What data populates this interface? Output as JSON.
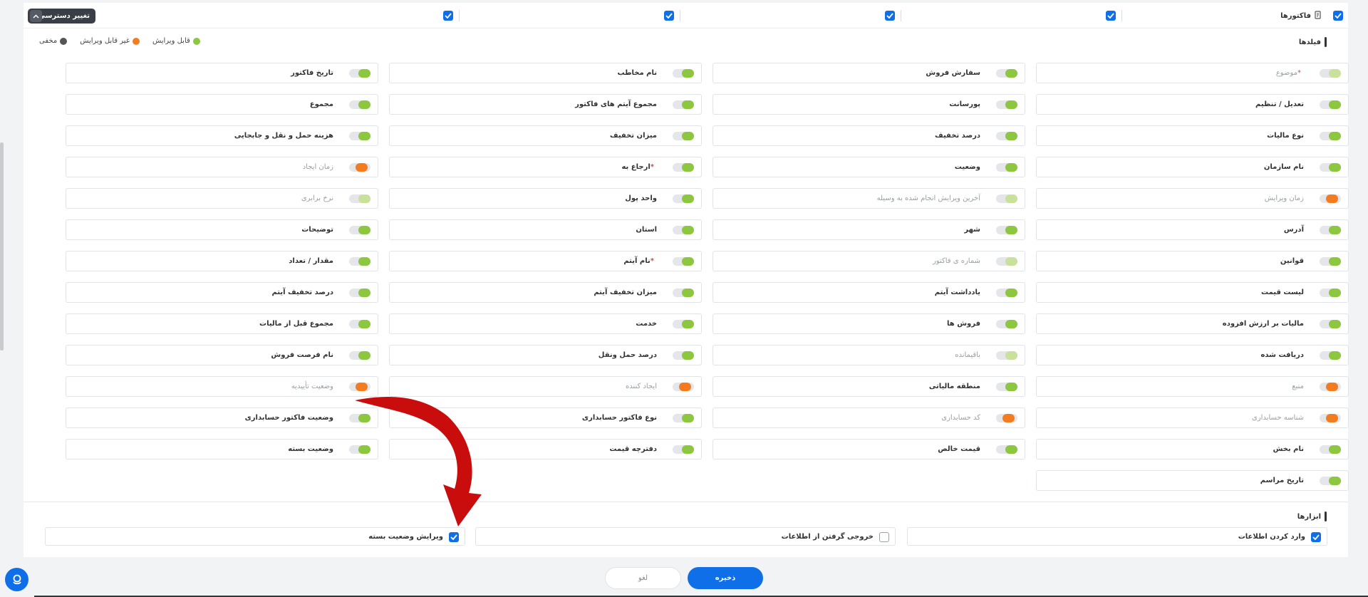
{
  "header": {
    "access_button_label": "تغییر دسترسی",
    "module_title": "فاکتورها"
  },
  "fields_section": {
    "title": "فیلدها",
    "legend": [
      {
        "label": "قابل ویرایش",
        "color": "#8dc63f"
      },
      {
        "label": "غیر قابل ویرایش",
        "color": "#f47c20"
      },
      {
        "label": "مخفی",
        "color": "#555555"
      }
    ],
    "rows": [
      [
        {
          "label": "موضوع",
          "required": true,
          "state": "hidden"
        },
        {
          "label": "سفارش فروش",
          "required": false,
          "state": "editable"
        },
        {
          "label": "نام مخاطب",
          "required": false,
          "state": "editable"
        },
        {
          "label": "تاریخ فاکتور",
          "required": false,
          "state": "editable"
        }
      ],
      [
        {
          "label": "تعدیل / تنظیم",
          "required": false,
          "state": "editable"
        },
        {
          "label": "پورسانت",
          "required": false,
          "state": "editable"
        },
        {
          "label": "مجموع آیتم های فاکتور",
          "required": false,
          "state": "editable"
        },
        {
          "label": "مجموع",
          "required": false,
          "state": "editable"
        }
      ],
      [
        {
          "label": "نوع مالیات",
          "required": false,
          "state": "editable"
        },
        {
          "label": "درصد تخفیف",
          "required": false,
          "state": "editable"
        },
        {
          "label": "میزان تخفیف",
          "required": false,
          "state": "editable"
        },
        {
          "label": "هزینه حمل و نقل و جابجایی",
          "required": false,
          "state": "editable"
        }
      ],
      [
        {
          "label": "نام سازمان",
          "required": false,
          "state": "editable"
        },
        {
          "label": "وضعیت",
          "required": false,
          "state": "editable"
        },
        {
          "label": "ارجاع به",
          "required": true,
          "state": "editable"
        },
        {
          "label": "زمان ایجاد",
          "required": false,
          "state": "readonly"
        }
      ],
      [
        {
          "label": "زمان ویرایش",
          "required": false,
          "state": "readonly"
        },
        {
          "label": "آخرین ویرایش انجام شده به وسیله",
          "required": false,
          "state": "hidden"
        },
        {
          "label": "واحد پول",
          "required": false,
          "state": "editable"
        },
        {
          "label": "نرخ برابری",
          "required": false,
          "state": "hidden"
        }
      ],
      [
        {
          "label": "آدرس",
          "required": false,
          "state": "editable"
        },
        {
          "label": "شهر",
          "required": false,
          "state": "editable"
        },
        {
          "label": "استان",
          "required": false,
          "state": "editable"
        },
        {
          "label": "توضیحات",
          "required": false,
          "state": "editable"
        }
      ],
      [
        {
          "label": "قوانین",
          "required": false,
          "state": "editable"
        },
        {
          "label": "شماره ی فاکتور",
          "required": false,
          "state": "hidden"
        },
        {
          "label": "نام آیتم",
          "required": true,
          "state": "editable"
        },
        {
          "label": "مقدار / تعداد",
          "required": false,
          "state": "editable"
        }
      ],
      [
        {
          "label": "لیست قیمت",
          "required": false,
          "state": "editable"
        },
        {
          "label": "یادداشت آیتم",
          "required": false,
          "state": "editable"
        },
        {
          "label": "میزان تخفیف آیتم",
          "required": false,
          "state": "editable"
        },
        {
          "label": "درصد تخفیف آیتم",
          "required": false,
          "state": "editable"
        }
      ],
      [
        {
          "label": "مالیات بر ارزش افزوده",
          "required": false,
          "state": "editable"
        },
        {
          "label": "فروش ها",
          "required": false,
          "state": "editable"
        },
        {
          "label": "خدمت",
          "required": false,
          "state": "editable"
        },
        {
          "label": "مجموع قبل از مالیات",
          "required": false,
          "state": "editable"
        }
      ],
      [
        {
          "label": "دریافت شده",
          "required": false,
          "state": "editable"
        },
        {
          "label": "باقیمانده",
          "required": false,
          "state": "hidden"
        },
        {
          "label": "درصد حمل ونقل",
          "required": false,
          "state": "editable"
        },
        {
          "label": "نام فرصت فروش",
          "required": false,
          "state": "editable"
        }
      ],
      [
        {
          "label": "منبع",
          "required": false,
          "state": "readonly"
        },
        {
          "label": "منطقه مالیاتی",
          "required": false,
          "state": "editable"
        },
        {
          "label": "ایجاد کننده",
          "required": false,
          "state": "readonly"
        },
        {
          "label": "وضعیت تأییدیه",
          "required": false,
          "state": "readonly"
        }
      ],
      [
        {
          "label": "شناسه حسابداری",
          "required": false,
          "state": "readonly"
        },
        {
          "label": "کد حسابداری",
          "required": false,
          "state": "readonly"
        },
        {
          "label": "نوع فاکتور حسابداری",
          "required": false,
          "state": "editable"
        },
        {
          "label": "وضعیت فاکتور حسابداری",
          "required": false,
          "state": "editable"
        }
      ],
      [
        {
          "label": "نام بخش",
          "required": false,
          "state": "editable"
        },
        {
          "label": "قیمت خالص",
          "required": false,
          "state": "editable"
        },
        {
          "label": "دفترچه قیمت",
          "required": false,
          "state": "editable"
        },
        {
          "label": "وضعیت بسته",
          "required": false,
          "state": "editable"
        }
      ],
      [
        {
          "label": "تاریخ مراسم",
          "required": false,
          "state": "editable"
        }
      ]
    ]
  },
  "tools_section": {
    "title": "ابزارها",
    "items": [
      {
        "label": "وارد کردن اطلاعات",
        "checked": true
      },
      {
        "label": "خروجی گرفتن از اطلاعات",
        "checked": false
      },
      {
        "label": "ویرایش وضعیت بسته",
        "checked": true
      }
    ]
  },
  "footer": {
    "save_label": "ذخیره",
    "cancel_label": "لغو"
  }
}
